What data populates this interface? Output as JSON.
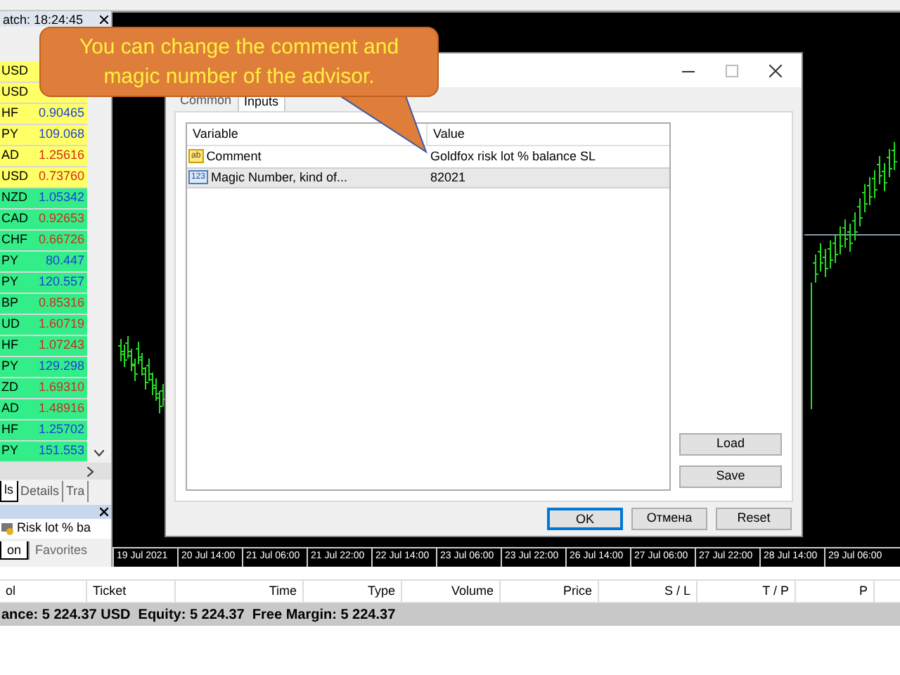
{
  "market_watch": {
    "title": "atch: 18:24:45",
    "rows": [
      {
        "symbol": "USD",
        "highlighted": true
      },
      {
        "symbol": "USD",
        "highlighted": true
      },
      {
        "symbol": "HF",
        "price": "0.90465",
        "up": true,
        "highlighted": true
      },
      {
        "symbol": "PY",
        "price": "109.068",
        "up": true,
        "highlighted": true
      },
      {
        "symbol": "AD",
        "price": "1.25616",
        "up": false,
        "highlighted": true
      },
      {
        "symbol": "USD",
        "price": "0.73760",
        "up": false,
        "highlighted": true
      },
      {
        "symbol": "NZD",
        "price": "1.05342",
        "up": true,
        "highlighted": false
      },
      {
        "symbol": "CAD",
        "price": "0.92653",
        "up": false,
        "highlighted": false
      },
      {
        "symbol": "CHF",
        "price": "0.66726",
        "up": false,
        "highlighted": false
      },
      {
        "symbol": "PY",
        "price": "80.447",
        "up": true,
        "highlighted": false
      },
      {
        "symbol": "PY",
        "price": "120.557",
        "up": true,
        "highlighted": false
      },
      {
        "symbol": "BP",
        "price": "0.85316",
        "up": false,
        "highlighted": false
      },
      {
        "symbol": "UD",
        "price": "1.60719",
        "up": false,
        "highlighted": false
      },
      {
        "symbol": "HF",
        "price": "1.07243",
        "up": false,
        "highlighted": false
      },
      {
        "symbol": "PY",
        "price": "129.298",
        "up": true,
        "highlighted": false
      },
      {
        "symbol": "ZD",
        "price": "1.69310",
        "up": false,
        "highlighted": false
      },
      {
        "symbol": "AD",
        "price": "1.48916",
        "up": false,
        "highlighted": false
      },
      {
        "symbol": "HF",
        "price": "1.25702",
        "up": true,
        "highlighted": false
      },
      {
        "symbol": "PY",
        "price": "151.553",
        "up": true,
        "highlighted": false
      }
    ],
    "tabs": [
      {
        "label": "ls",
        "selected": true
      },
      {
        "label": "Details",
        "selected": false
      },
      {
        "label": "Tra",
        "selected": false
      }
    ]
  },
  "navigator": {
    "item": "Risk lot % ba",
    "tabs": [
      {
        "label": "on",
        "selected": true
      },
      {
        "label": "Favorites",
        "selected": false
      }
    ]
  },
  "callout": {
    "text": "You can change the comment and magic number of the advisor."
  },
  "dialog": {
    "tabs": [
      {
        "label": "Common",
        "selected": false
      },
      {
        "label": "Inputs",
        "selected": true
      }
    ],
    "columns": [
      "Variable",
      "Value"
    ],
    "rows": [
      {
        "kind": "text",
        "icon_label": "ab",
        "variable": "Comment",
        "value": "Goldfox risk lot % balance SL",
        "selected": false
      },
      {
        "kind": "number",
        "icon_label": "123",
        "variable": "Magic Number, kind of...",
        "value": "82021",
        "selected": true
      }
    ],
    "side_buttons": [
      "Load",
      "Save"
    ],
    "buttons": [
      {
        "label": "OK",
        "default": true
      },
      {
        "label": "Отмена",
        "default": false
      },
      {
        "label": "Reset",
        "default": false
      }
    ]
  },
  "time_axis": [
    "19 Jul 2021",
    "20 Jul 14:00",
    "21 Jul 06:00",
    "21 Jul 22:00",
    "22 Jul 14:00",
    "23 Jul 06:00",
    "23 Jul 22:00",
    "26 Jul 14:00",
    "27 Jul 06:00",
    "27 Jul 22:00",
    "28 Jul 14:00",
    "29 Jul 06:00"
  ],
  "toolbox": {
    "columns": [
      {
        "label": "ol",
        "right_aligned": false
      },
      {
        "label": "Ticket",
        "right_aligned": false
      },
      {
        "label": "Time",
        "right_aligned": true
      },
      {
        "label": "Type",
        "right_aligned": true
      },
      {
        "label": "Volume",
        "right_aligned": true
      },
      {
        "label": "Price",
        "right_aligned": true
      },
      {
        "label": "S / L",
        "right_aligned": true
      },
      {
        "label": "T / P",
        "right_aligned": true
      },
      {
        "label": "P",
        "right_aligned": true
      }
    ],
    "status": "ance: 5 224.37 USD  Equity: 5 224.37  Free Margin: 5 224.37"
  }
}
